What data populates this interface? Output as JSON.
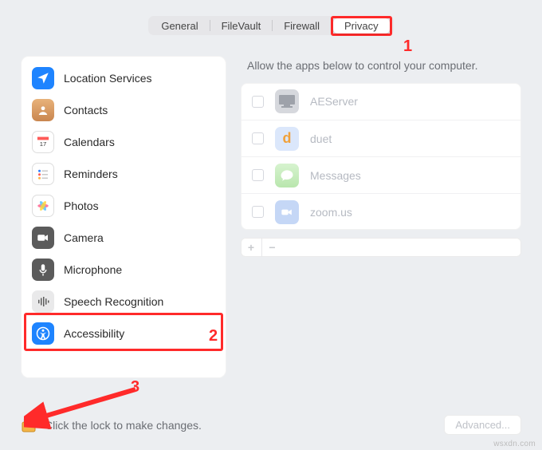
{
  "tabs": {
    "items": [
      {
        "label": "General"
      },
      {
        "label": "FileVault"
      },
      {
        "label": "Firewall"
      },
      {
        "label": "Privacy"
      }
    ],
    "active_index": 3
  },
  "sidebar": {
    "items": [
      {
        "label": "Location Services",
        "icon": "location-icon",
        "color": "#1e84ff"
      },
      {
        "label": "Contacts",
        "icon": "contacts-icon",
        "color": "#e0a36b"
      },
      {
        "label": "Calendars",
        "icon": "calendar-icon",
        "color": "#ffffff"
      },
      {
        "label": "Reminders",
        "icon": "reminders-icon",
        "color": "#ffffff"
      },
      {
        "label": "Photos",
        "icon": "photos-icon",
        "color": "#ffffff"
      },
      {
        "label": "Camera",
        "icon": "camera-icon",
        "color": "#5b5b5b"
      },
      {
        "label": "Microphone",
        "icon": "microphone-icon",
        "color": "#5b5b5b"
      },
      {
        "label": "Speech Recognition",
        "icon": "speech-icon",
        "color": "#e9e9ea"
      },
      {
        "label": "Accessibility",
        "icon": "accessibility-icon",
        "color": "#1e84ff"
      }
    ],
    "selected_index": 8
  },
  "right": {
    "heading": "Allow the apps below to control your computer.",
    "apps": [
      {
        "name": "AEServer",
        "icon_color": "#b8bcc3"
      },
      {
        "name": "duet",
        "icon_color": "#c6d8f4",
        "letter": "d",
        "letter_color": "#f1a13a"
      },
      {
        "name": "Messages",
        "icon_color": "#cfeec8"
      },
      {
        "name": "zoom.us",
        "icon_color": "#b9cdf5"
      }
    ],
    "add_label": "+",
    "remove_label": "−"
  },
  "bottom": {
    "lock_text": "Click the lock to make changes.",
    "advanced_label": "Advanced..."
  },
  "annotations": {
    "a1": "1",
    "a2": "2",
    "a3": "3"
  },
  "watermark": "wsxdn.com"
}
